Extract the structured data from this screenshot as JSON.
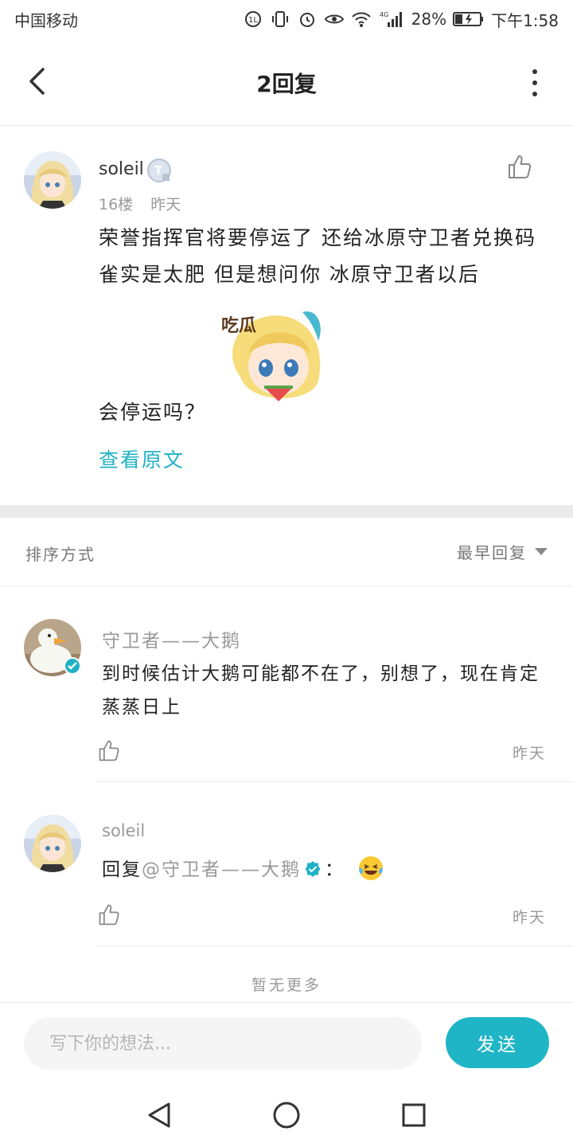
{
  "status_bar": {
    "carrier": "中国移动",
    "network": "4G",
    "battery": "28%",
    "time": "下午1:58"
  },
  "header": {
    "title": "2回复"
  },
  "post": {
    "author": "soleil",
    "floor": "16楼",
    "time": "昨天",
    "body": "荣誉指挥官将要停运了  还给冰原守卫者兑换码  雀实是太肥  但是想问你  冰原守卫者以后",
    "body_tail": "会停运吗？",
    "sticker_caption": "吃瓜",
    "view_original": "查看原文"
  },
  "sort": {
    "label": "排序方式",
    "selected": "最早回复"
  },
  "replies": [
    {
      "author": "守卫者——大鹅",
      "content": "到时候估计大鹅可能都不在了，别想了，现在肯定蒸蒸日上",
      "time": "昨天"
    },
    {
      "author": "soleil",
      "reply_prefix": "回复",
      "mention": "@守卫者——大鹅",
      "colon": "：",
      "time": "昨天"
    }
  ],
  "footer": {
    "no_more": "暂无更多"
  },
  "composer": {
    "placeholder": "写下你的想法...",
    "send_label": "发送"
  },
  "colors": {
    "accent": "#1fb5c6",
    "muted_text": "#999999",
    "divider": "#ececec"
  }
}
